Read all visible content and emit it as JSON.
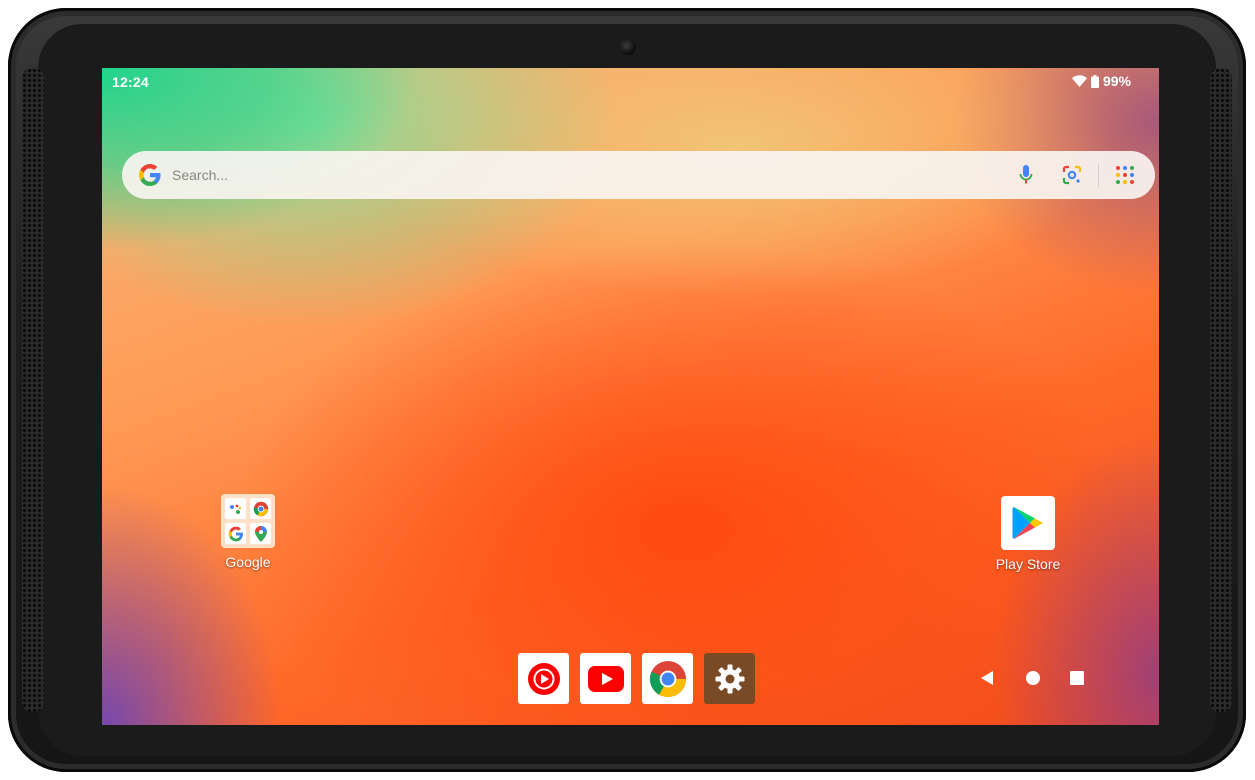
{
  "status_bar": {
    "time": "12:24",
    "battery_percent": "99%",
    "wifi_icon": "wifi-icon",
    "battery_icon": "battery-icon"
  },
  "search": {
    "placeholder": "Search...",
    "icons": [
      "google-logo-icon",
      "microphone-icon",
      "google-lens-icon",
      "app-grid-icon"
    ]
  },
  "home": {
    "folder": {
      "label": "Google",
      "apps": [
        "google-assistant-icon",
        "chrome-icon",
        "google-icon",
        "maps-icon"
      ]
    },
    "play_store": {
      "label": "Play Store",
      "icon": "play-store-icon"
    }
  },
  "dock": {
    "apps": [
      "youtube-music-icon",
      "youtube-icon",
      "chrome-icon",
      "settings-icon"
    ]
  },
  "nav": {
    "icons": [
      "back-icon",
      "home-icon",
      "recents-icon"
    ]
  },
  "colors": {
    "bezel": "#1b1b1b",
    "youtube_red": "#ff0000",
    "settings_brown": "#7a4a24",
    "search_bar": "#f8f4f0"
  }
}
